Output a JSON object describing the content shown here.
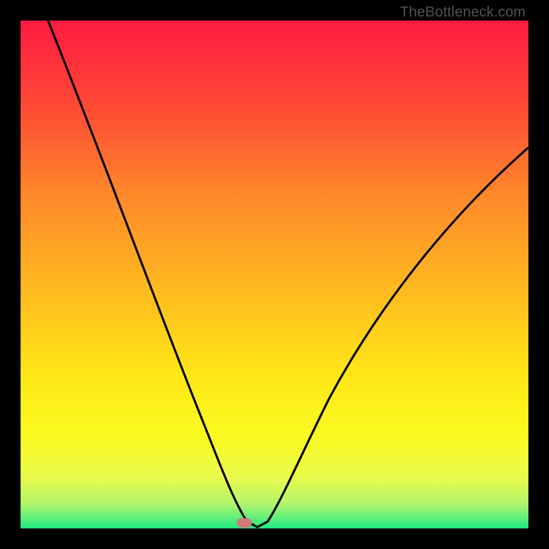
{
  "watermark": "TheBottleneck.com",
  "chart_data": {
    "type": "line",
    "title": "",
    "xlabel": "",
    "ylabel": "",
    "xlim": [
      0,
      100
    ],
    "ylim": [
      0,
      100
    ],
    "x": [
      0,
      5,
      10,
      15,
      20,
      25,
      30,
      35,
      40,
      42,
      44,
      46,
      48,
      50,
      55,
      60,
      65,
      70,
      75,
      80,
      85,
      90,
      95,
      100
    ],
    "values": [
      100,
      87,
      74,
      62,
      50,
      39,
      28,
      17,
      8,
      4,
      1,
      0,
      1,
      3,
      10,
      18,
      27,
      36,
      44,
      52,
      59,
      65,
      71,
      76
    ],
    "minimum_x": 46,
    "gradient": {
      "top_color": "#fe1b42",
      "upper_mid_color": "#fe8a2a",
      "mid_color": "#fee716",
      "lower_mid_color": "#f4fb39",
      "bottom_color": "#1cea80"
    },
    "marker": {
      "x": 46,
      "y": 0,
      "color": "#cf7a7a"
    }
  }
}
